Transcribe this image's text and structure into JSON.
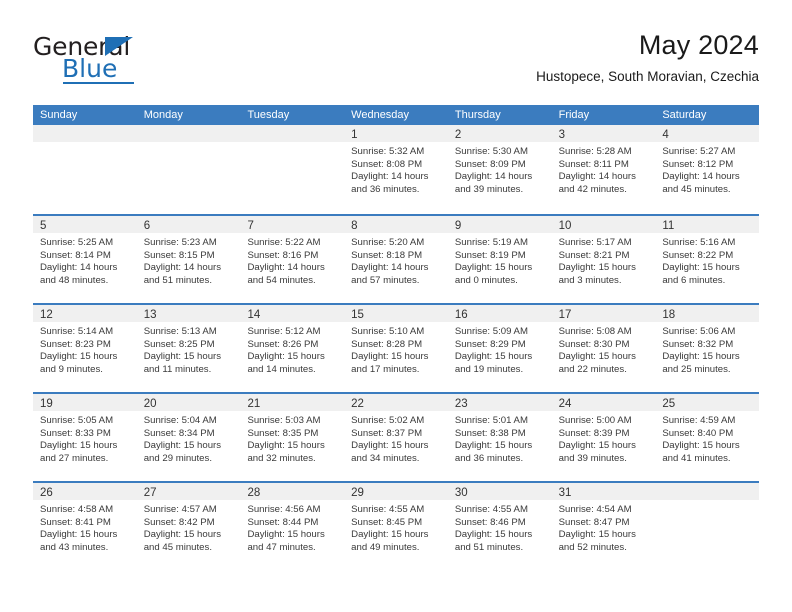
{
  "logo": {
    "word_one": "General",
    "word_two": "Blue",
    "accent_color": "#1f6fb5",
    "triangle_icon": "triangle-icon"
  },
  "header": {
    "title": "May 2024",
    "subtitle": "Hustopece, South Moravian, Czechia"
  },
  "calendar": {
    "header_bg": "#3b7cbf",
    "day_band_bg": "#f0f0f0",
    "weekdays": [
      "Sunday",
      "Monday",
      "Tuesday",
      "Wednesday",
      "Thursday",
      "Friday",
      "Saturday"
    ],
    "weeks": [
      [
        {
          "empty": true
        },
        {
          "empty": true
        },
        {
          "empty": true
        },
        {
          "date": "1",
          "sunrise": "Sunrise: 5:32 AM",
          "sunset": "Sunset: 8:08 PM",
          "daylight_1": "Daylight: 14 hours",
          "daylight_2": "and 36 minutes."
        },
        {
          "date": "2",
          "sunrise": "Sunrise: 5:30 AM",
          "sunset": "Sunset: 8:09 PM",
          "daylight_1": "Daylight: 14 hours",
          "daylight_2": "and 39 minutes."
        },
        {
          "date": "3",
          "sunrise": "Sunrise: 5:28 AM",
          "sunset": "Sunset: 8:11 PM",
          "daylight_1": "Daylight: 14 hours",
          "daylight_2": "and 42 minutes."
        },
        {
          "date": "4",
          "sunrise": "Sunrise: 5:27 AM",
          "sunset": "Sunset: 8:12 PM",
          "daylight_1": "Daylight: 14 hours",
          "daylight_2": "and 45 minutes."
        }
      ],
      [
        {
          "date": "5",
          "sunrise": "Sunrise: 5:25 AM",
          "sunset": "Sunset: 8:14 PM",
          "daylight_1": "Daylight: 14 hours",
          "daylight_2": "and 48 minutes."
        },
        {
          "date": "6",
          "sunrise": "Sunrise: 5:23 AM",
          "sunset": "Sunset: 8:15 PM",
          "daylight_1": "Daylight: 14 hours",
          "daylight_2": "and 51 minutes."
        },
        {
          "date": "7",
          "sunrise": "Sunrise: 5:22 AM",
          "sunset": "Sunset: 8:16 PM",
          "daylight_1": "Daylight: 14 hours",
          "daylight_2": "and 54 minutes."
        },
        {
          "date": "8",
          "sunrise": "Sunrise: 5:20 AM",
          "sunset": "Sunset: 8:18 PM",
          "daylight_1": "Daylight: 14 hours",
          "daylight_2": "and 57 minutes."
        },
        {
          "date": "9",
          "sunrise": "Sunrise: 5:19 AM",
          "sunset": "Sunset: 8:19 PM",
          "daylight_1": "Daylight: 15 hours",
          "daylight_2": "and 0 minutes."
        },
        {
          "date": "10",
          "sunrise": "Sunrise: 5:17 AM",
          "sunset": "Sunset: 8:21 PM",
          "daylight_1": "Daylight: 15 hours",
          "daylight_2": "and 3 minutes."
        },
        {
          "date": "11",
          "sunrise": "Sunrise: 5:16 AM",
          "sunset": "Sunset: 8:22 PM",
          "daylight_1": "Daylight: 15 hours",
          "daylight_2": "and 6 minutes."
        }
      ],
      [
        {
          "date": "12",
          "sunrise": "Sunrise: 5:14 AM",
          "sunset": "Sunset: 8:23 PM",
          "daylight_1": "Daylight: 15 hours",
          "daylight_2": "and 9 minutes."
        },
        {
          "date": "13",
          "sunrise": "Sunrise: 5:13 AM",
          "sunset": "Sunset: 8:25 PM",
          "daylight_1": "Daylight: 15 hours",
          "daylight_2": "and 11 minutes."
        },
        {
          "date": "14",
          "sunrise": "Sunrise: 5:12 AM",
          "sunset": "Sunset: 8:26 PM",
          "daylight_1": "Daylight: 15 hours",
          "daylight_2": "and 14 minutes."
        },
        {
          "date": "15",
          "sunrise": "Sunrise: 5:10 AM",
          "sunset": "Sunset: 8:28 PM",
          "daylight_1": "Daylight: 15 hours",
          "daylight_2": "and 17 minutes."
        },
        {
          "date": "16",
          "sunrise": "Sunrise: 5:09 AM",
          "sunset": "Sunset: 8:29 PM",
          "daylight_1": "Daylight: 15 hours",
          "daylight_2": "and 19 minutes."
        },
        {
          "date": "17",
          "sunrise": "Sunrise: 5:08 AM",
          "sunset": "Sunset: 8:30 PM",
          "daylight_1": "Daylight: 15 hours",
          "daylight_2": "and 22 minutes."
        },
        {
          "date": "18",
          "sunrise": "Sunrise: 5:06 AM",
          "sunset": "Sunset: 8:32 PM",
          "daylight_1": "Daylight: 15 hours",
          "daylight_2": "and 25 minutes."
        }
      ],
      [
        {
          "date": "19",
          "sunrise": "Sunrise: 5:05 AM",
          "sunset": "Sunset: 8:33 PM",
          "daylight_1": "Daylight: 15 hours",
          "daylight_2": "and 27 minutes."
        },
        {
          "date": "20",
          "sunrise": "Sunrise: 5:04 AM",
          "sunset": "Sunset: 8:34 PM",
          "daylight_1": "Daylight: 15 hours",
          "daylight_2": "and 29 minutes."
        },
        {
          "date": "21",
          "sunrise": "Sunrise: 5:03 AM",
          "sunset": "Sunset: 8:35 PM",
          "daylight_1": "Daylight: 15 hours",
          "daylight_2": "and 32 minutes."
        },
        {
          "date": "22",
          "sunrise": "Sunrise: 5:02 AM",
          "sunset": "Sunset: 8:37 PM",
          "daylight_1": "Daylight: 15 hours",
          "daylight_2": "and 34 minutes."
        },
        {
          "date": "23",
          "sunrise": "Sunrise: 5:01 AM",
          "sunset": "Sunset: 8:38 PM",
          "daylight_1": "Daylight: 15 hours",
          "daylight_2": "and 36 minutes."
        },
        {
          "date": "24",
          "sunrise": "Sunrise: 5:00 AM",
          "sunset": "Sunset: 8:39 PM",
          "daylight_1": "Daylight: 15 hours",
          "daylight_2": "and 39 minutes."
        },
        {
          "date": "25",
          "sunrise": "Sunrise: 4:59 AM",
          "sunset": "Sunset: 8:40 PM",
          "daylight_1": "Daylight: 15 hours",
          "daylight_2": "and 41 minutes."
        }
      ],
      [
        {
          "date": "26",
          "sunrise": "Sunrise: 4:58 AM",
          "sunset": "Sunset: 8:41 PM",
          "daylight_1": "Daylight: 15 hours",
          "daylight_2": "and 43 minutes."
        },
        {
          "date": "27",
          "sunrise": "Sunrise: 4:57 AM",
          "sunset": "Sunset: 8:42 PM",
          "daylight_1": "Daylight: 15 hours",
          "daylight_2": "and 45 minutes."
        },
        {
          "date": "28",
          "sunrise": "Sunrise: 4:56 AM",
          "sunset": "Sunset: 8:44 PM",
          "daylight_1": "Daylight: 15 hours",
          "daylight_2": "and 47 minutes."
        },
        {
          "date": "29",
          "sunrise": "Sunrise: 4:55 AM",
          "sunset": "Sunset: 8:45 PM",
          "daylight_1": "Daylight: 15 hours",
          "daylight_2": "and 49 minutes."
        },
        {
          "date": "30",
          "sunrise": "Sunrise: 4:55 AM",
          "sunset": "Sunset: 8:46 PM",
          "daylight_1": "Daylight: 15 hours",
          "daylight_2": "and 51 minutes."
        },
        {
          "date": "31",
          "sunrise": "Sunrise: 4:54 AM",
          "sunset": "Sunset: 8:47 PM",
          "daylight_1": "Daylight: 15 hours",
          "daylight_2": "and 52 minutes."
        },
        {
          "empty": true
        }
      ]
    ]
  }
}
